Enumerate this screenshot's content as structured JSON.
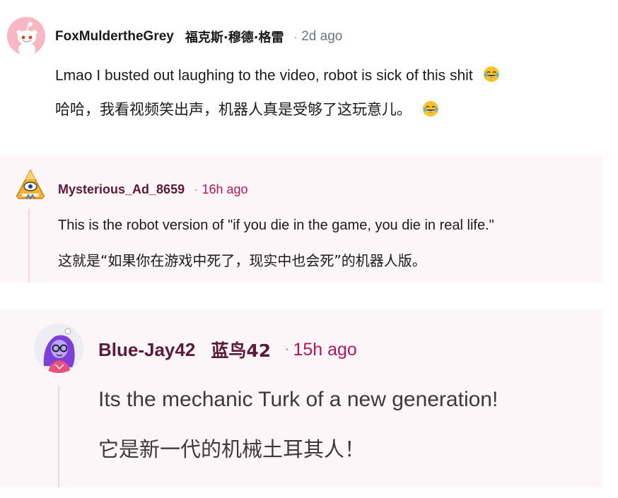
{
  "colors": {
    "reply_background": "#fdf6f8",
    "time_accent": "#b0175a",
    "username_dark": "#5b1a36",
    "thread_line": "#f0d6dd"
  },
  "comments": [
    {
      "username": "FoxMuldertheGrey",
      "username_zh": "福克斯·穆德·格雷",
      "separator": "·",
      "time": "2d ago",
      "text_en": "Lmao I busted out laughing to the video, robot is sick of this shit",
      "text_zh": "哈哈，我看视频笑出声，机器人真是受够了这玩意儿。",
      "emoji": "laughing-crying-emoji",
      "avatar": "reddit-snoo-avatar"
    },
    {
      "username": "Mysterious_Ad_8659",
      "separator": "·",
      "time": "16h ago",
      "text_en": "This is the robot version of \"if you die in the game, you die in real life.\"",
      "text_zh": "这就是“如果你在游戏中死了，现实中也会死”的机器人版。",
      "avatar": "illuminati-eye-avatar"
    },
    {
      "username": "Blue-Jay42",
      "username_zh": "蓝鸟42",
      "separator": "·",
      "time": "15h ago",
      "text_en": "Its the mechanic Turk of a new generation!",
      "text_zh": "它是新一代的机械土耳其人！",
      "avatar": "purple-hair-avatar"
    }
  ]
}
